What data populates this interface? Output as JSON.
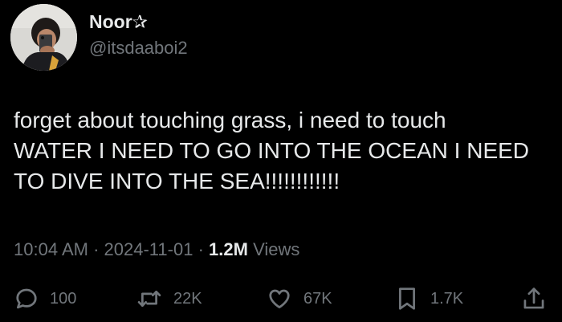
{
  "author": {
    "display_name": "Noor",
    "badge_glyph": "✰",
    "handle": "@itsdaaboi2"
  },
  "tweet": {
    "lines": [
      "forget about touching grass, i need to touch",
      "WATER I NEED TO GO INTO THE OCEAN I NEED",
      "TO DIVE INTO THE SEA!!!!!!!!!!!!"
    ]
  },
  "meta": {
    "time": "10:04 AM",
    "separator": "·",
    "date": "2024-11-01",
    "views_count": "1.2M",
    "views_label": "Views"
  },
  "actions": {
    "replies": "100",
    "reposts": "22K",
    "likes": "67K",
    "bookmarks": "1.7K"
  },
  "colors": {
    "background": "#000000",
    "primary_text": "#e7e9ea",
    "secondary_text": "#71767b"
  },
  "icons": {
    "reply": "reply-icon",
    "repost": "repost-icon",
    "like": "heart-icon",
    "bookmark": "bookmark-icon",
    "share": "share-icon"
  }
}
